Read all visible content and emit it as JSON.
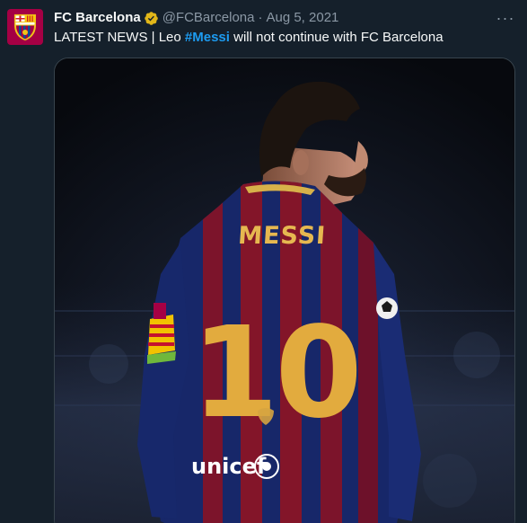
{
  "tweet": {
    "author_name": "FC Barcelona",
    "handle": "@FCBarcelona",
    "separator": "·",
    "date": "Aug 5, 2021",
    "more_label": "···",
    "text_prefix": "LATEST NEWS | Leo ",
    "hashtag": "#Messi",
    "text_suffix": " will not continue with FC Barcelona"
  },
  "media": {
    "jersey_name": "MESSI",
    "jersey_number": "10",
    "sponsor": "unicef"
  },
  "icons": {
    "verified": "verified-badge-icon",
    "avatar": "fc-barcelona-crest-icon",
    "more": "more-options-icon"
  },
  "colors": {
    "background": "#15202b",
    "hashtag": "#1d9bf0",
    "verified_gold": "#e2b719",
    "secondary_text": "#8b98a5"
  }
}
